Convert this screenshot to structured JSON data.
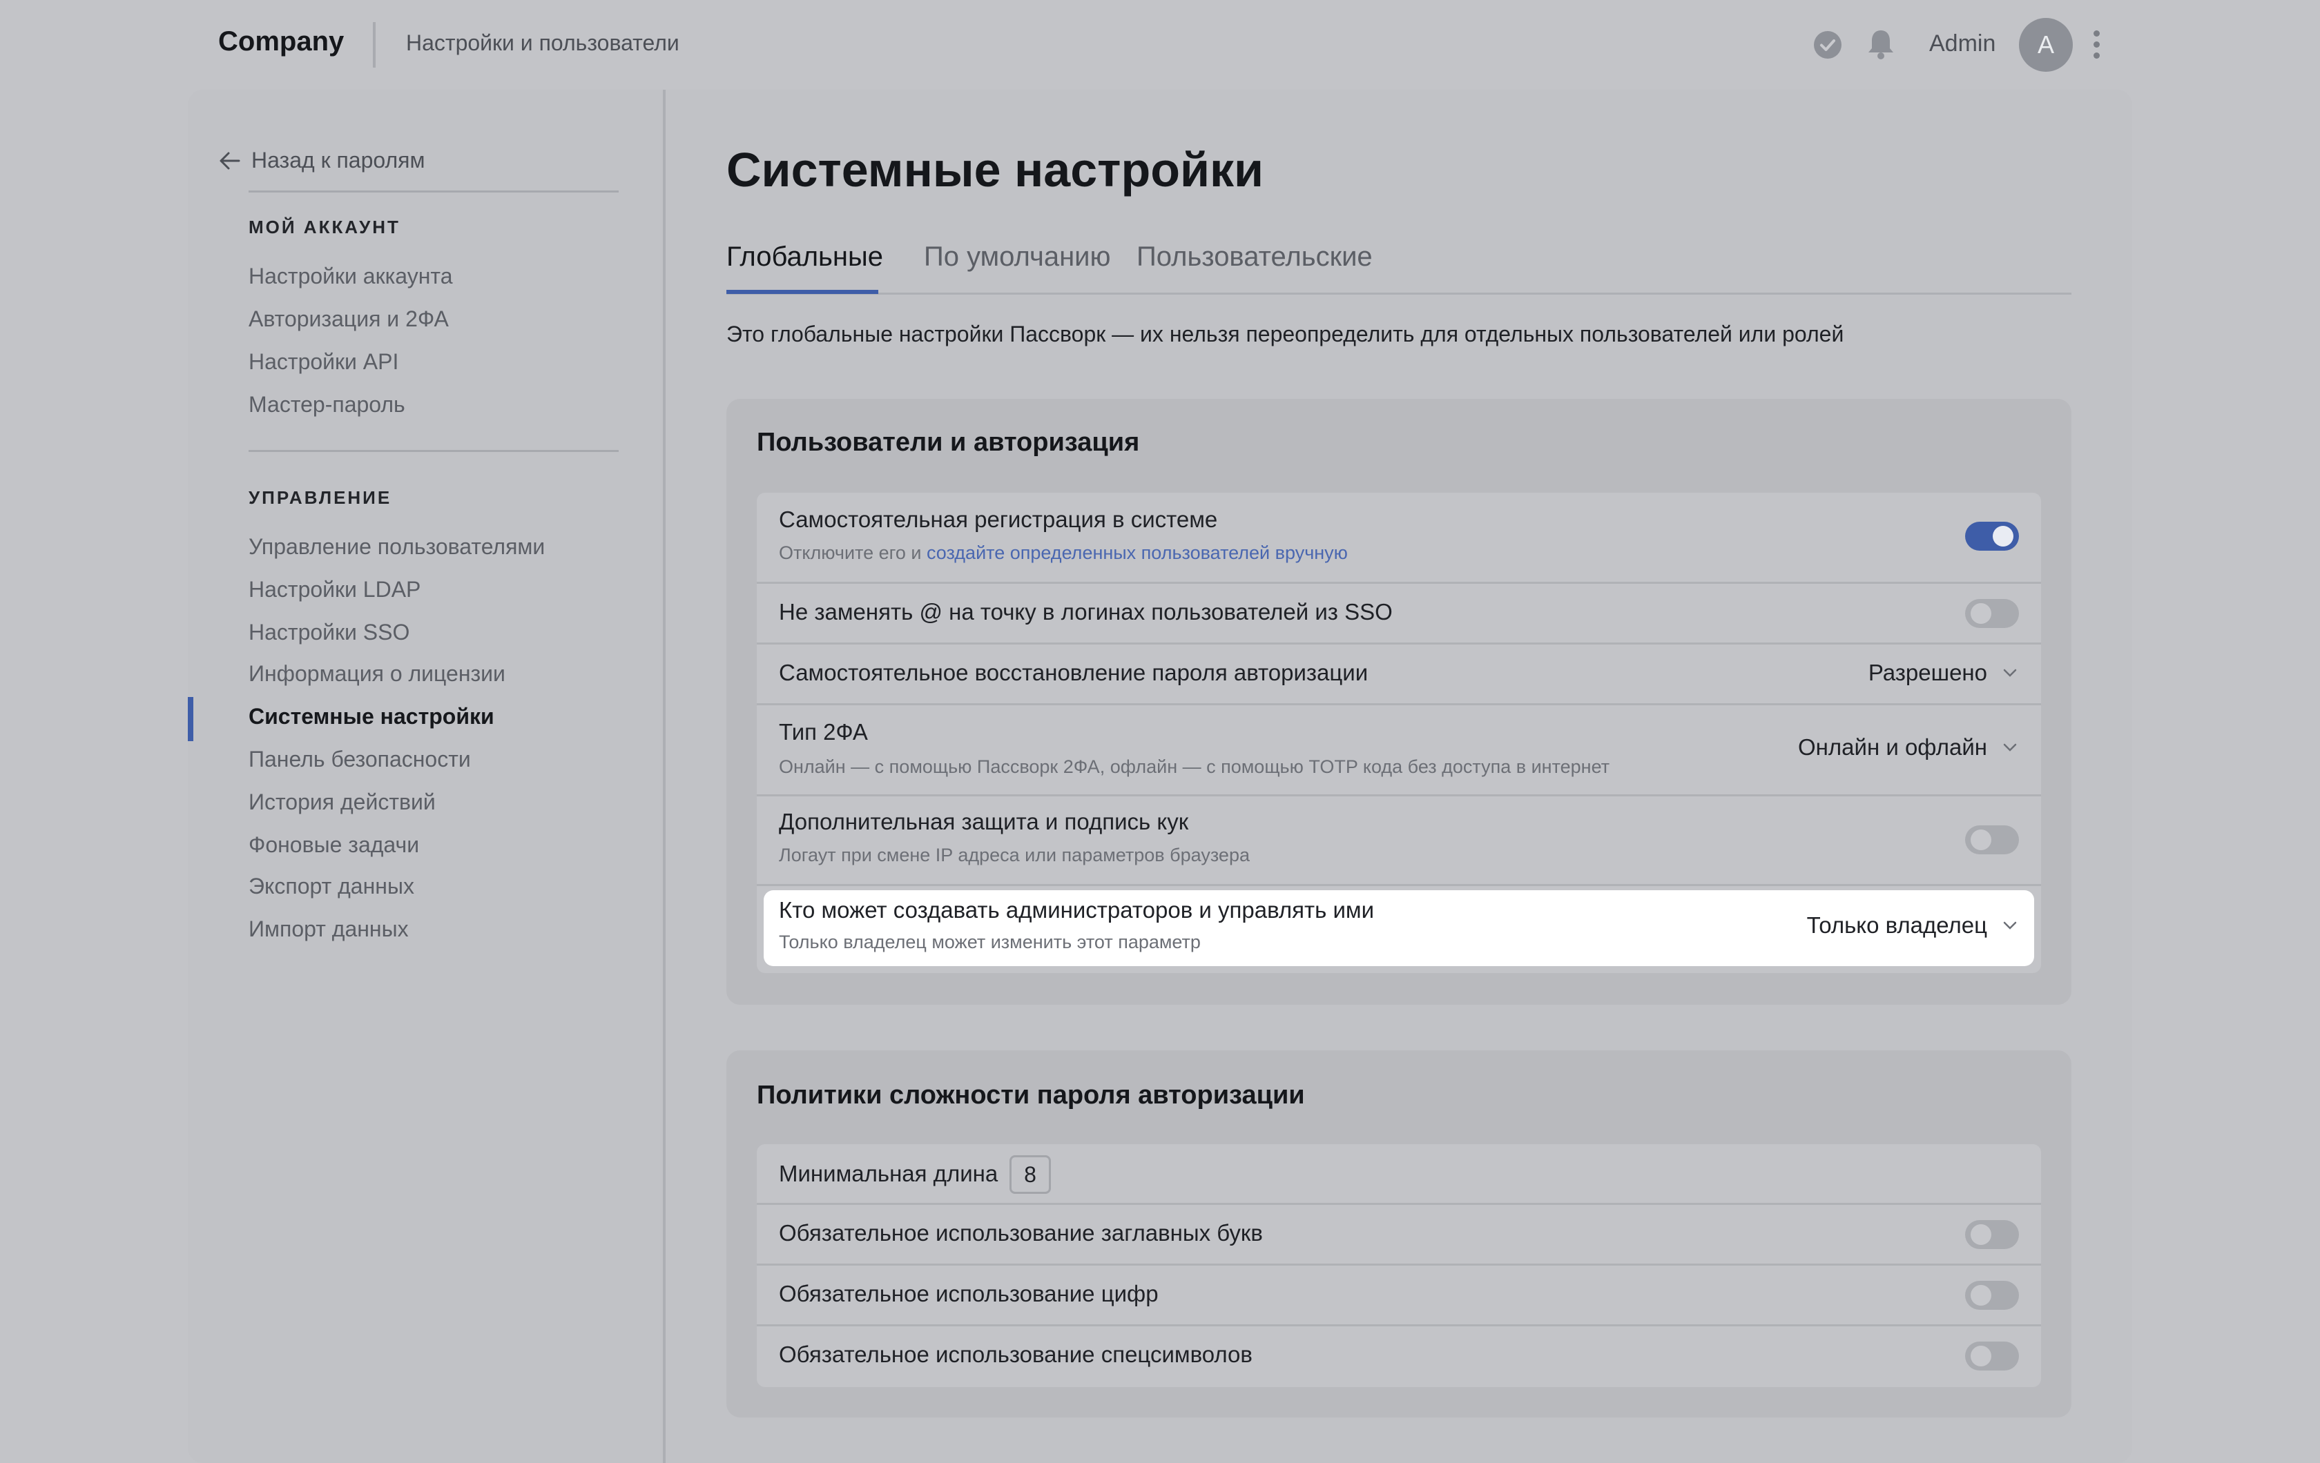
{
  "header": {
    "brand": "Company",
    "section": "Настройки и пользователи",
    "user": "Admin",
    "avatar_letter": "A"
  },
  "sidebar": {
    "back_label": "Назад к паролям",
    "account_heading": "МОЙ АККАУНТ",
    "account_items": [
      "Настройки аккаунта",
      "Авторизация и 2ФА",
      "Настройки API",
      "Мастер-пароль"
    ],
    "manage_heading": "УПРАВЛЕНИЕ",
    "manage_items": [
      "Управление пользователями",
      "Настройки LDAP",
      "Настройки SSO",
      "Информация о лицензии",
      "Системные настройки",
      "Панель безопасности",
      "История действий",
      "Фоновые задачи",
      "Экспорт данных",
      "Импорт данных"
    ],
    "active_item": "Системные настройки"
  },
  "main": {
    "title": "Системные настройки",
    "tabs": [
      "Глобальные",
      "По умолчанию",
      "Пользовательские"
    ],
    "active_tab": "Глобальные",
    "description": "Это глобальные настройки Пассворк — их нельзя переопределить для отдельных пользователей или ролей"
  },
  "users_card": {
    "title": "Пользователи и авторизация",
    "self_registration": {
      "label": "Самостоятельная регистрация в системе",
      "hint_prefix": "Отключите его и ",
      "hint_link": "создайте определенных пользователей вручную",
      "enabled": true
    },
    "sso_at": {
      "label": "Не заменять @ на точку в логинах пользователей из SSO",
      "enabled": false
    },
    "self_recovery": {
      "label": "Самостоятельное восстановление пароля авторизации",
      "value": "Разрешено"
    },
    "twofa": {
      "label": "Тип 2ФА",
      "hint": "Онлайн — с помощью Пассворк 2ФА, офлайн — с помощью TOTP кода без доступа в интернет",
      "value": "Онлайн и офлайн"
    },
    "cookie": {
      "label": "Дополнительная защита и подпись кук",
      "hint": "Логаут при смене IP адреса или параметров браузера",
      "enabled": false
    },
    "admins": {
      "label": "Кто может создавать администраторов и управлять ими",
      "hint": "Только владелец может изменить этот параметр",
      "value": "Только владелец"
    }
  },
  "password_card": {
    "title": "Политики сложности пароля авторизации",
    "min_length_label": "Минимальная длина",
    "min_length_value": "8",
    "uppercase": {
      "label": "Обязательное использование заглавных букв",
      "enabled": false
    },
    "digits": {
      "label": "Обязательное использование цифр",
      "enabled": false
    },
    "symbols": {
      "label": "Обязательное использование спецсимволов",
      "enabled": false
    }
  },
  "colors": {
    "accent": "#3e5da8",
    "link": "#4a67b0",
    "overlay_bg": "#c3c4c8",
    "highlight": "#ffffff"
  }
}
